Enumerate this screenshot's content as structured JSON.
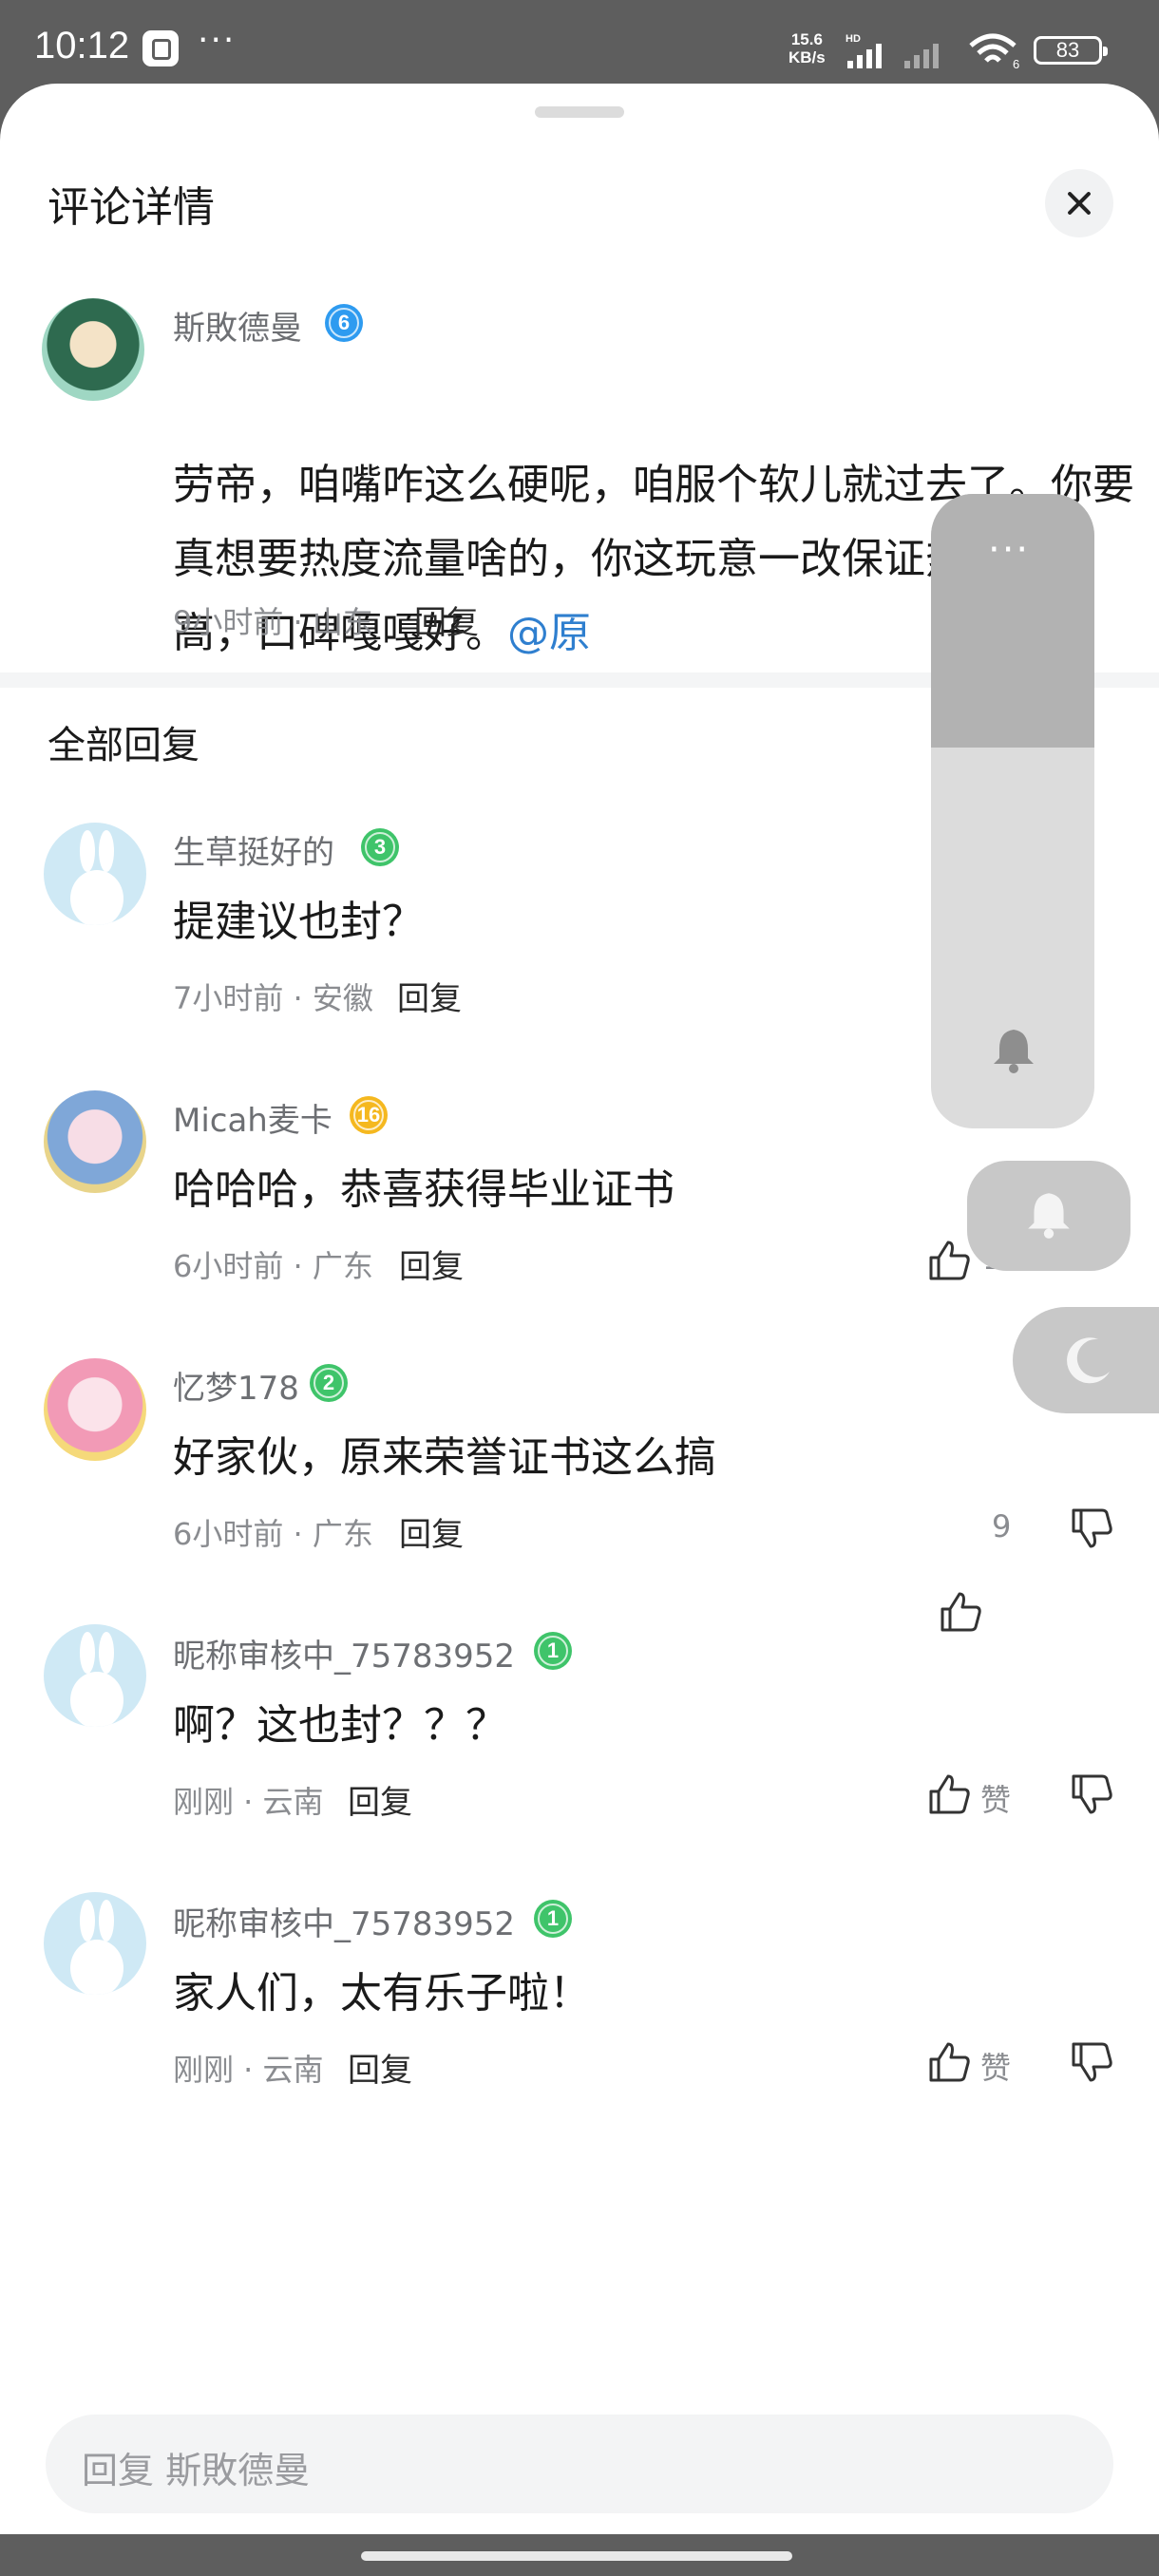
{
  "status_bar": {
    "time": "10:12",
    "more": "···",
    "net_speed": "15.6",
    "net_unit": "KB/s",
    "hd": "HD",
    "wifi_label": "6",
    "battery": "83"
  },
  "sheet": {
    "title": "评论详情",
    "section_title": "全部回复"
  },
  "main_comment": {
    "username": "斯敗德曼",
    "level": "6",
    "text": "劳帝，咱嘴咋这么硬呢，咱服个软儿就过去了。你要真想要热度流量啥的，你这玩意一改保证热度嘎嘎高，口碑嘎嘎好。",
    "mention": "@原",
    "meta": "9小时前 · 山东",
    "reply": "回复"
  },
  "replies": [
    {
      "username": "生草挺好的",
      "level": "3",
      "text": "提建议也封？",
      "meta": "7小时前 · 安徽",
      "reply": "回复",
      "likes": ""
    },
    {
      "username": "Micah麦卡",
      "level": "16",
      "text": "哈哈哈，恭喜获得毕业证书",
      "meta": "6小时前 · 广东",
      "reply": "回复",
      "likes": "16"
    },
    {
      "username": "忆梦178",
      "level": "2",
      "text": "好家伙，原来荣誉证书这么搞",
      "meta": "6小时前 · 广东",
      "reply": "回复",
      "likes": "9"
    },
    {
      "username": "昵称审核中_75783952",
      "level": "1",
      "text": "啊？这也封？？？",
      "meta": "刚刚 · 云南",
      "reply": "回复",
      "likes": "赞"
    },
    {
      "username": "昵称审核中_75783952",
      "level": "1",
      "text": "家人们，太有乐子啦！",
      "meta": "刚刚 · 云南",
      "reply": "回复",
      "likes": "赞"
    }
  ],
  "reply_input": {
    "placeholder": "回复 斯敗德曼"
  },
  "overlay": {
    "menu_dots": "···",
    "volume_level": 0.6
  },
  "icons": {
    "close": "close-icon",
    "like": "thumbs-up-icon",
    "dislike": "thumbs-down-icon",
    "bell": "bell-icon",
    "moon": "moon-icon"
  }
}
